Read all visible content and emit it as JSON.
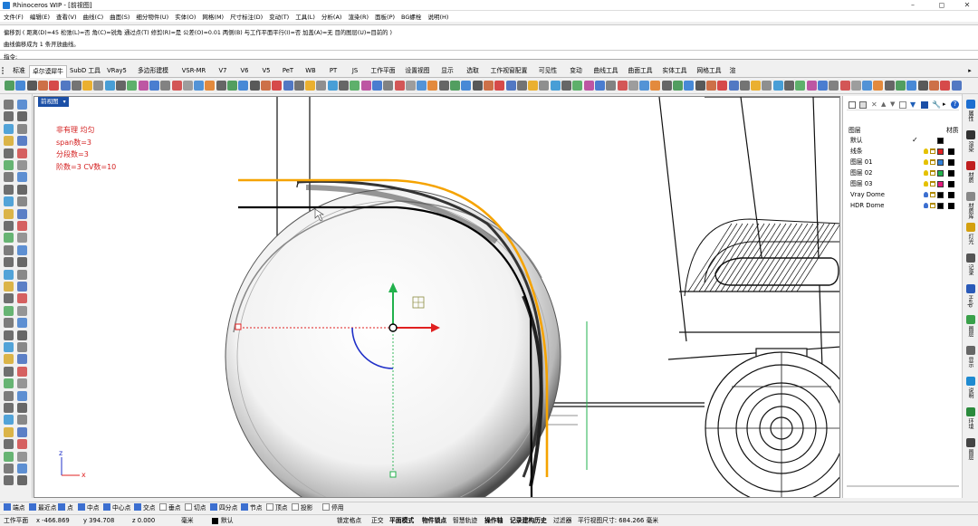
{
  "window": {
    "title": "Rhinoceros WIP - [前视图]",
    "controls": [
      "–",
      "◻",
      "✕"
    ]
  },
  "menu": [
    "文件(F)",
    "编辑(E)",
    "查看(V)",
    "曲线(C)",
    "曲面(S)",
    "细分物件(U)",
    "实体(O)",
    "网格(M)",
    "尺寸标注(D)",
    "变动(T)",
    "工具(L)",
    "分析(A)",
    "渲染(R)",
    "面板(P)",
    "BG螺栓",
    "说明(H)"
  ],
  "command": {
    "history": [
      "偏移到 ( 距离(D)=45  松弛(L)=否  角(C)=锐角  通过点(T)  修剪(R)=是  公差(O)=0.01  两侧(B)  与工作平面平行(I)=否  加盖(A)=无  目的图层(U)=目前的 )",
      "曲线偏移成为 1 条开放曲线。"
    ],
    "prompt": "指令:"
  },
  "tabs": [
    {
      "label": "标准",
      "active": false
    },
    {
      "label": "卓尔谟犀牛",
      "active": true
    },
    {
      "label": "SubD 工具",
      "active": false
    },
    {
      "label": "VRay5",
      "active": false
    },
    {
      "label": "多边形建模",
      "active": false
    },
    {
      "label": "VSR-MR",
      "active": false
    },
    {
      "label": "V7",
      "active": false
    },
    {
      "label": "V6",
      "active": false
    },
    {
      "label": "V5",
      "active": false
    },
    {
      "label": "PeT",
      "active": false
    },
    {
      "label": "WB",
      "active": false
    },
    {
      "label": "PT",
      "active": false
    },
    {
      "label": "JS",
      "active": false
    },
    {
      "label": "工作平面",
      "active": false
    },
    {
      "label": "设置视图",
      "active": false
    },
    {
      "label": "显示",
      "active": false
    },
    {
      "label": "选取",
      "active": false
    },
    {
      "label": "工作视窗配置",
      "active": false
    },
    {
      "label": "可见性",
      "active": false
    },
    {
      "label": "变动",
      "active": false
    },
    {
      "label": "曲线工具",
      "active": false
    },
    {
      "label": "曲面工具",
      "active": false
    },
    {
      "label": "实体工具",
      "active": false
    },
    {
      "label": "网格工具",
      "active": false
    },
    {
      "label": "渲",
      "active": false
    }
  ],
  "viewport": {
    "name": "前视图",
    "notes": [
      "非有理  均匀",
      "span数=3",
      "分段数=3",
      "阶数=3   CV数=10"
    ],
    "axes": {
      "x": "x",
      "z": "z"
    }
  },
  "layers_panel": {
    "header": "图层",
    "material_header": "材质",
    "layers": [
      {
        "name": "默认",
        "current": true,
        "color": "#000000",
        "bulb": "yellow"
      },
      {
        "name": "线条",
        "current": false,
        "color": "#e02020",
        "bulb": "yellow"
      },
      {
        "name": "图层 01",
        "current": false,
        "color": "#2f7fd8",
        "bulb": "yellow"
      },
      {
        "name": "图层 02",
        "current": false,
        "color": "#22b14c",
        "bulb": "yellow"
      },
      {
        "name": "图层 03",
        "current": false,
        "color": "#e0187a",
        "bulb": "yellow"
      },
      {
        "name": "Vray Dome",
        "current": false,
        "color": "#000000",
        "bulb": "blue"
      },
      {
        "name": "HDR Dome",
        "current": false,
        "color": "#000000",
        "bulb": "blue"
      }
    ],
    "current_mark": "✓"
  },
  "right_tabs": [
    "属性",
    "渲染",
    "材质",
    "材质库",
    "灯光",
    "记录",
    "Help",
    "图层",
    "显示",
    "说明",
    "环境",
    "图层"
  ],
  "osnap": [
    {
      "label": "端点",
      "checked": true
    },
    {
      "label": "最近点",
      "checked": true
    },
    {
      "label": "点",
      "checked": true
    },
    {
      "label": "中点",
      "checked": true
    },
    {
      "label": "中心点",
      "checked": true
    },
    {
      "label": "交点",
      "checked": true
    },
    {
      "label": "垂点",
      "checked": false
    },
    {
      "label": "切点",
      "checked": false
    },
    {
      "label": "四分点",
      "checked": true
    },
    {
      "label": "节点",
      "checked": true
    },
    {
      "label": "顶点",
      "checked": false
    },
    {
      "label": "投影",
      "checked": false
    },
    {
      "label": "停用",
      "checked": false
    }
  ],
  "status": {
    "cplane": "工作平面",
    "x": "x -466.869",
    "y": "y 394.708",
    "z": "z 0.000",
    "units": "毫米",
    "layer": "默认",
    "grid_snap": "锁定格点",
    "ortho": "正交",
    "planar": "平面模式",
    "osnap": "物件锁点",
    "smarttrack": "智慧轨迹",
    "gumball": "操作轴",
    "history": "记录建构历史",
    "filter": "过滤器",
    "viewport_size": "平行视图尺寸: 684.266 毫米"
  },
  "colors": {
    "curve_highlight": "#f5a300",
    "gumball_x": "#e02020",
    "gumball_z": "#22b14c",
    "viewport_label_bg": "#1b4fa6",
    "note_text": "#d42020"
  }
}
